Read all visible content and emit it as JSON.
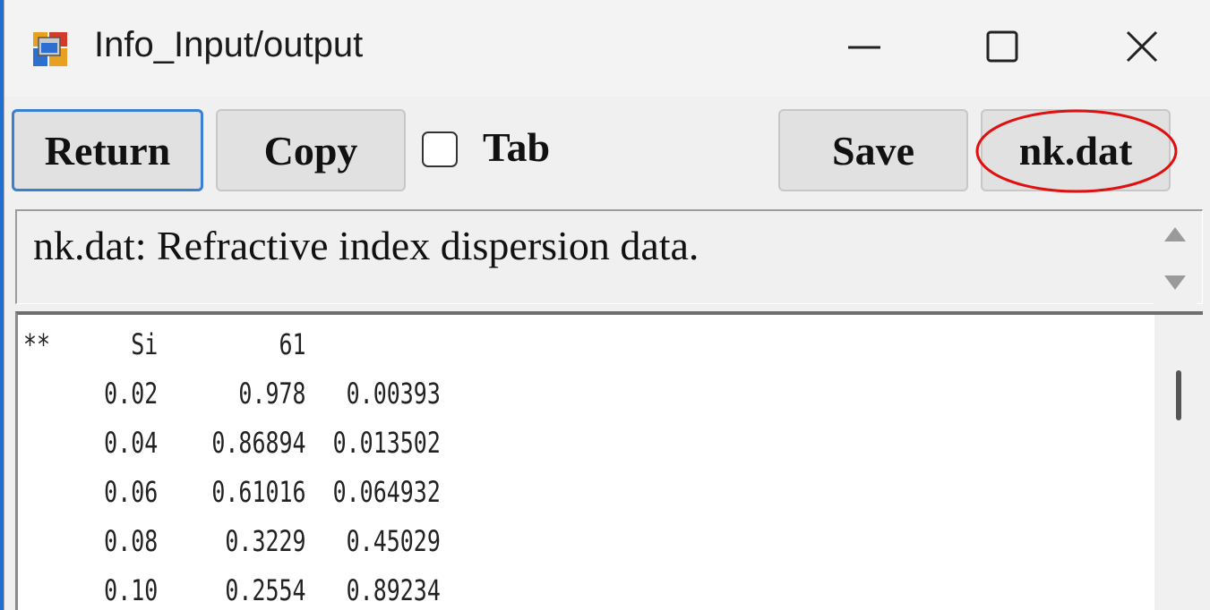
{
  "window": {
    "title": "Info_Input/output",
    "controls": {
      "minimize_icon": "minimize-icon",
      "maximize_icon": "maximize-icon",
      "close_icon": "close-icon"
    }
  },
  "toolbar": {
    "return_label": "Return",
    "copy_label": "Copy",
    "tab_checkbox_label": "Tab",
    "tab_checked": false,
    "save_label": "Save",
    "nkdat_label": "nk.dat",
    "highlight_color": "#e01010"
  },
  "description": {
    "text": "nk.dat: Refractive index dispersion data."
  },
  "data_lines": [
    "**      Si         61",
    "      0.02      0.978   0.00393",
    "      0.04    0.86894  0.013502",
    "      0.06    0.61016  0.064932",
    "      0.08     0.3229   0.45029",
    "      0.10     0.2554   0.89234"
  ]
}
